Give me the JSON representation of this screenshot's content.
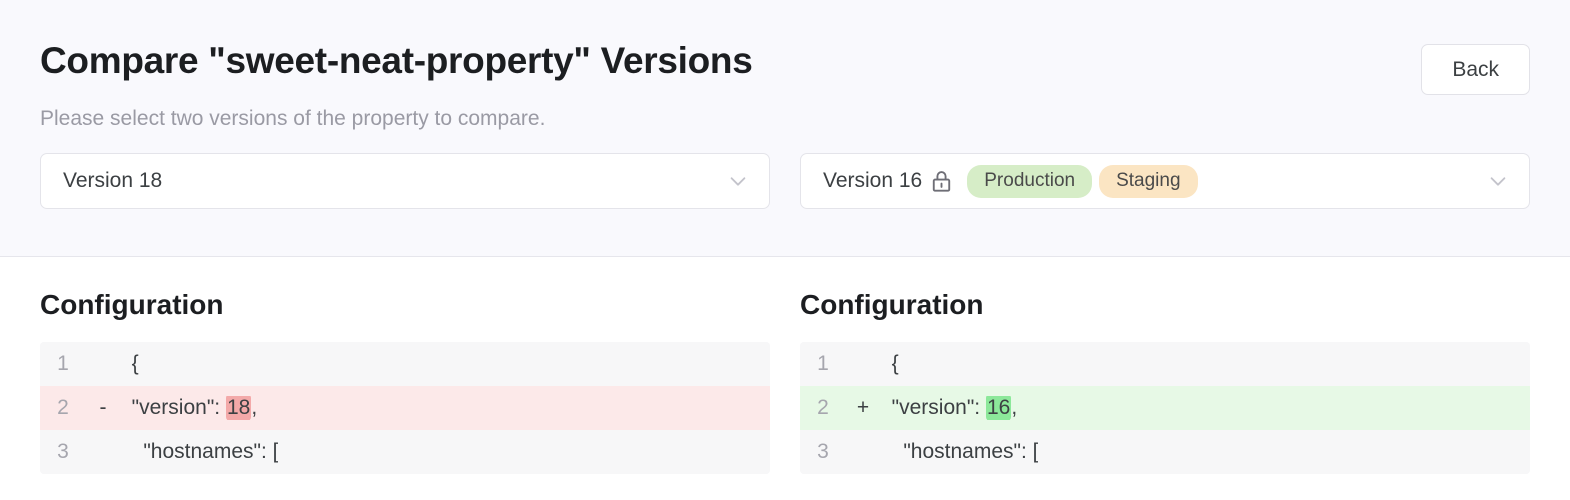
{
  "header": {
    "title": "Compare \"sweet-neat-property\" Versions",
    "subtitle": "Please select two versions of the property to compare.",
    "back_label": "Back"
  },
  "selectors": {
    "left": {
      "value": "Version 18",
      "chevron_icon": "chevron-down-icon",
      "locked": false,
      "badges": []
    },
    "right": {
      "value": "Version 16",
      "chevron_icon": "chevron-down-icon",
      "locked": true,
      "lock_icon": "lock-icon",
      "badges": [
        {
          "label": "Production",
          "color": "#d6edc7"
        },
        {
          "label": "Staging",
          "color": "#fbe5c3"
        }
      ]
    }
  },
  "diff": {
    "left": {
      "heading": "Configuration",
      "lines": [
        {
          "number": "1",
          "marker": "",
          "prefix": "  {",
          "token": "",
          "suffix": "",
          "state": "context"
        },
        {
          "number": "2",
          "marker": "-",
          "prefix": "  \"version\": ",
          "token": "18",
          "suffix": ",",
          "state": "removed"
        },
        {
          "number": "3",
          "marker": "",
          "prefix": "    \"hostnames\": [",
          "token": "",
          "suffix": "",
          "state": "context"
        }
      ]
    },
    "right": {
      "heading": "Configuration",
      "lines": [
        {
          "number": "1",
          "marker": "",
          "prefix": "  {",
          "token": "",
          "suffix": "",
          "state": "context"
        },
        {
          "number": "2",
          "marker": "+",
          "prefix": "  \"version\": ",
          "token": "16",
          "suffix": ",",
          "state": "added"
        },
        {
          "number": "3",
          "marker": "",
          "prefix": "    \"hostnames\": [",
          "token": "",
          "suffix": "",
          "state": "context"
        }
      ]
    }
  },
  "colors": {
    "header_bg": "#f9f9fd",
    "removed_row": "#fce9e9",
    "added_row": "#e7f9e6",
    "removed_token": "#f3a9a9",
    "added_token": "#8ce89a",
    "context_row": "#f7f7f8"
  }
}
